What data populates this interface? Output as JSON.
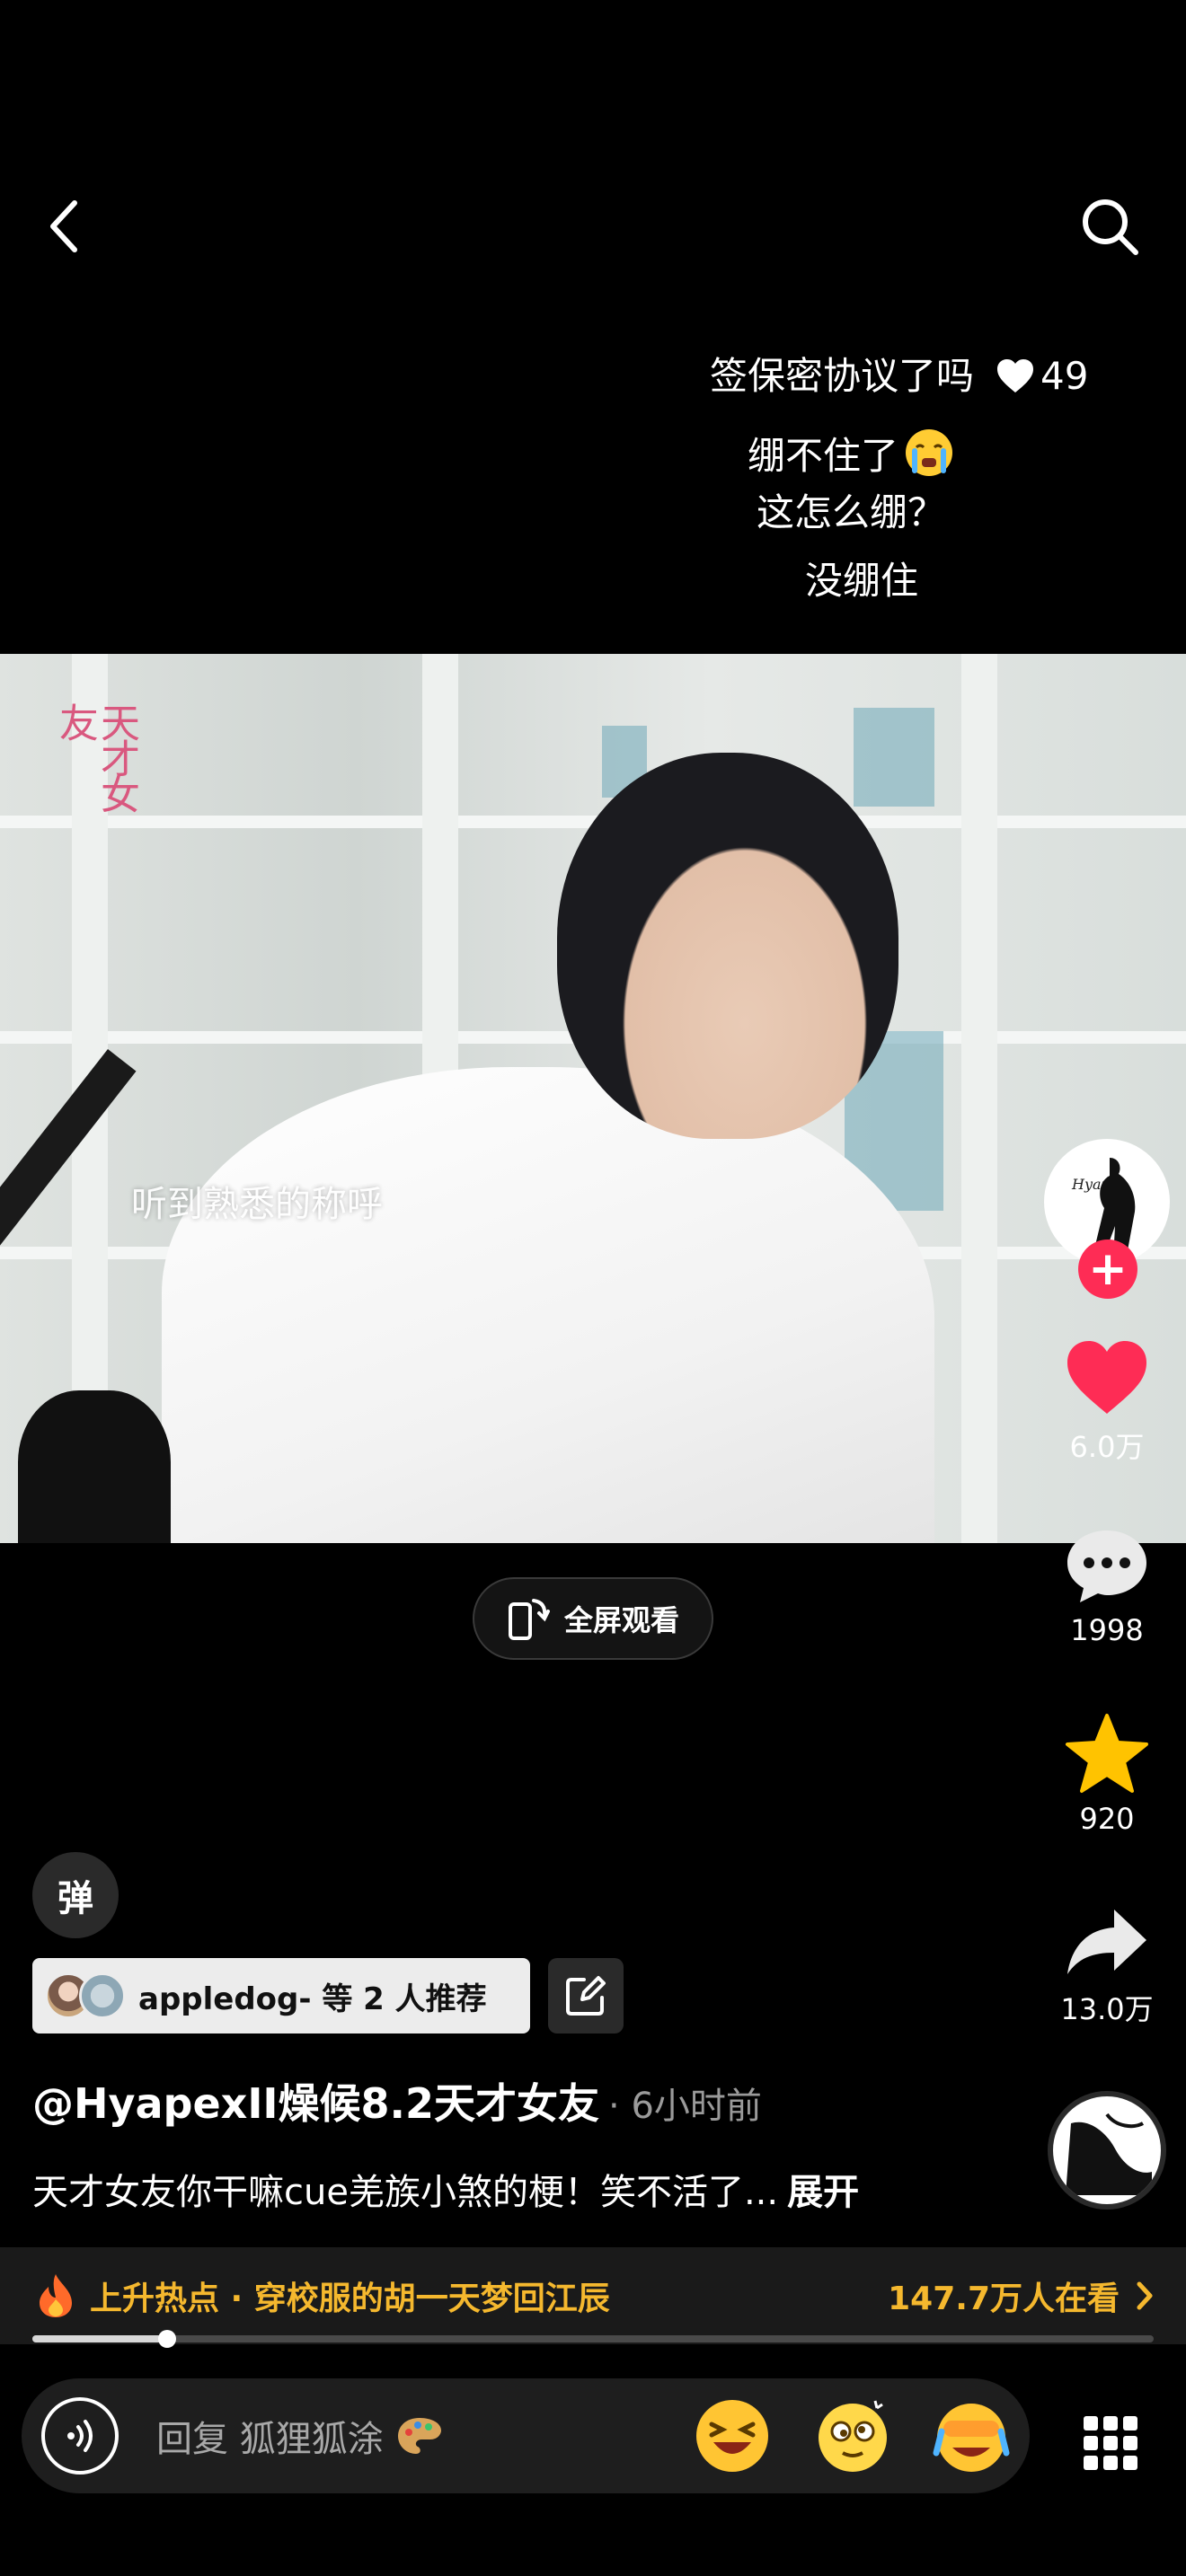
{
  "nav": {
    "back_icon": "chevron-left-icon",
    "search_icon": "search-icon"
  },
  "danmaku": [
    {
      "text": "签保密协议了吗",
      "likes": "49"
    },
    {
      "text": "绷不住了",
      "emoji": "crying-face"
    },
    {
      "text": "这怎么绷？"
    },
    {
      "text": "没绷住"
    }
  ],
  "video": {
    "logo_text": "天才女友",
    "subtitle": "听到熟悉的称呼"
  },
  "fullscreen": {
    "label": "全屏观看"
  },
  "rail": {
    "avatar_label": "Hyapex",
    "likes": "6.0万",
    "comments": "1998",
    "favorites": "920",
    "shares": "13.0万"
  },
  "danmaku_toggle": {
    "label": "弹"
  },
  "recommend": {
    "text": "appledog- 等 2 人推荐"
  },
  "post": {
    "author": "@HyapexII燥候8.2天才女友",
    "time": "· 6小时前",
    "caption": "天才女友你干嘛cue羌族小煞的梗！笑不活了...",
    "expand_label": "展开"
  },
  "hot": {
    "title": "上升热点 · 穿校服的胡一天梦回江辰",
    "viewers": "147.7万人在看"
  },
  "progress": {
    "fraction": 0.12
  },
  "reply": {
    "placeholder": "回复 狐狸狐涂"
  },
  "colors": {
    "like": "#fe2c55",
    "favorite": "#ffc300",
    "hot": "#f5b82e"
  }
}
